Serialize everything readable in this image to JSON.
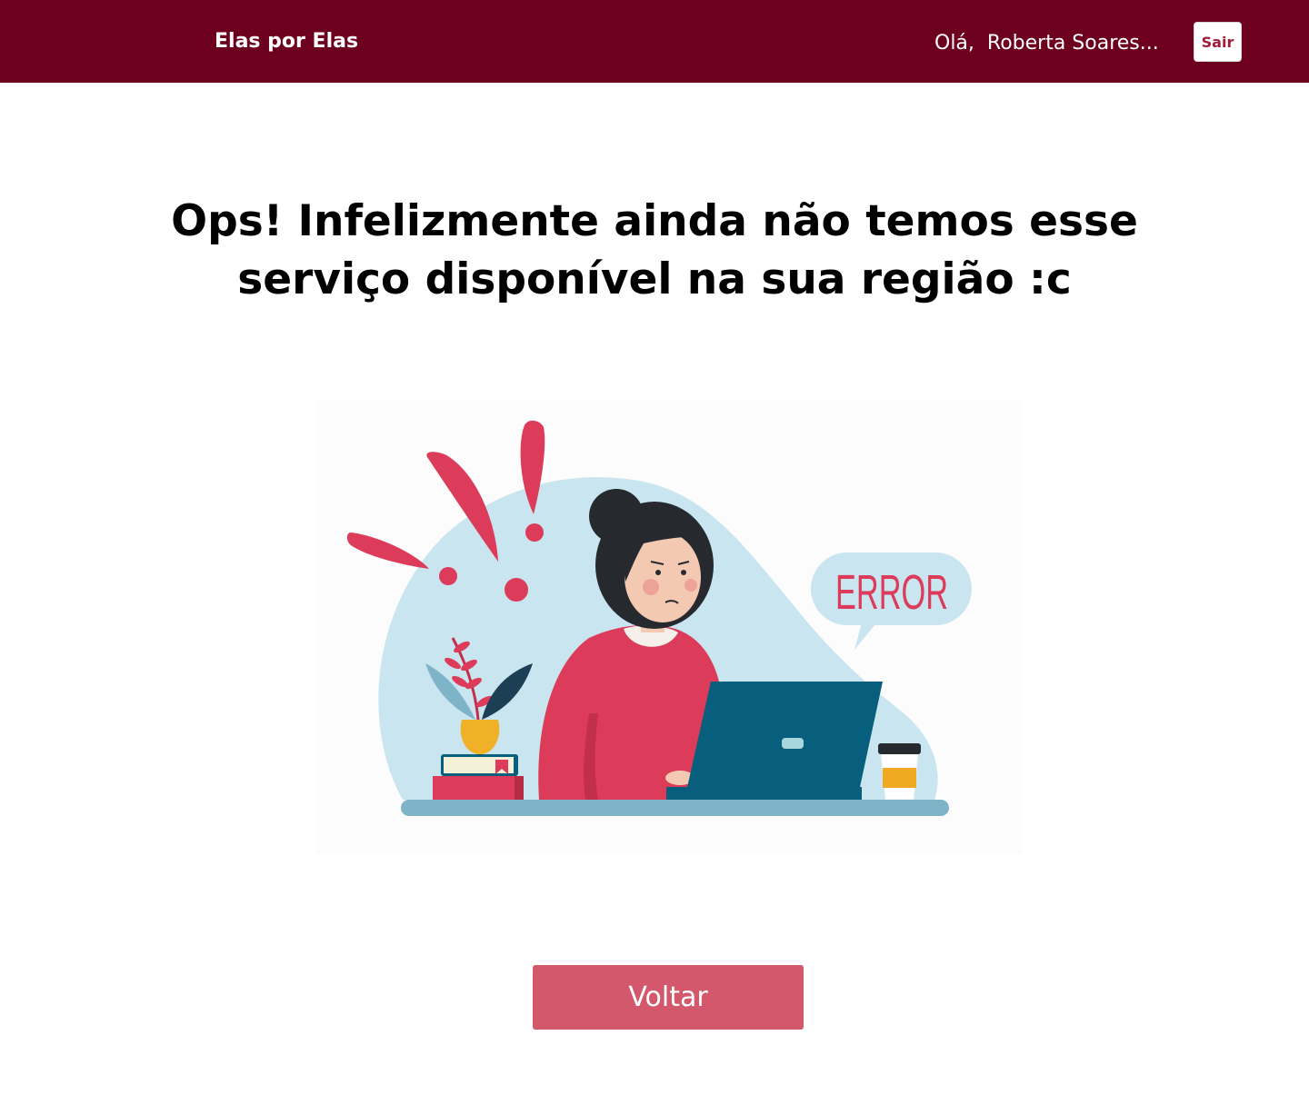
{
  "header": {
    "brand": "Elas por Elas",
    "greeting": "Olá,  Roberta Soares...",
    "logout_label": "Sair"
  },
  "main": {
    "title": "Ops! Infelizmente ainda não temos esse serviço disponível na sua região :c",
    "illustration": {
      "speech_bubble_text": "ERROR"
    },
    "back_label": "Voltar"
  },
  "colors": {
    "header_bg": "#6d001f",
    "accent": "#d3586c",
    "alert_red": "#dc3b5a",
    "blob_blue": "#c9e5f0",
    "laptop": "#075f7d"
  }
}
